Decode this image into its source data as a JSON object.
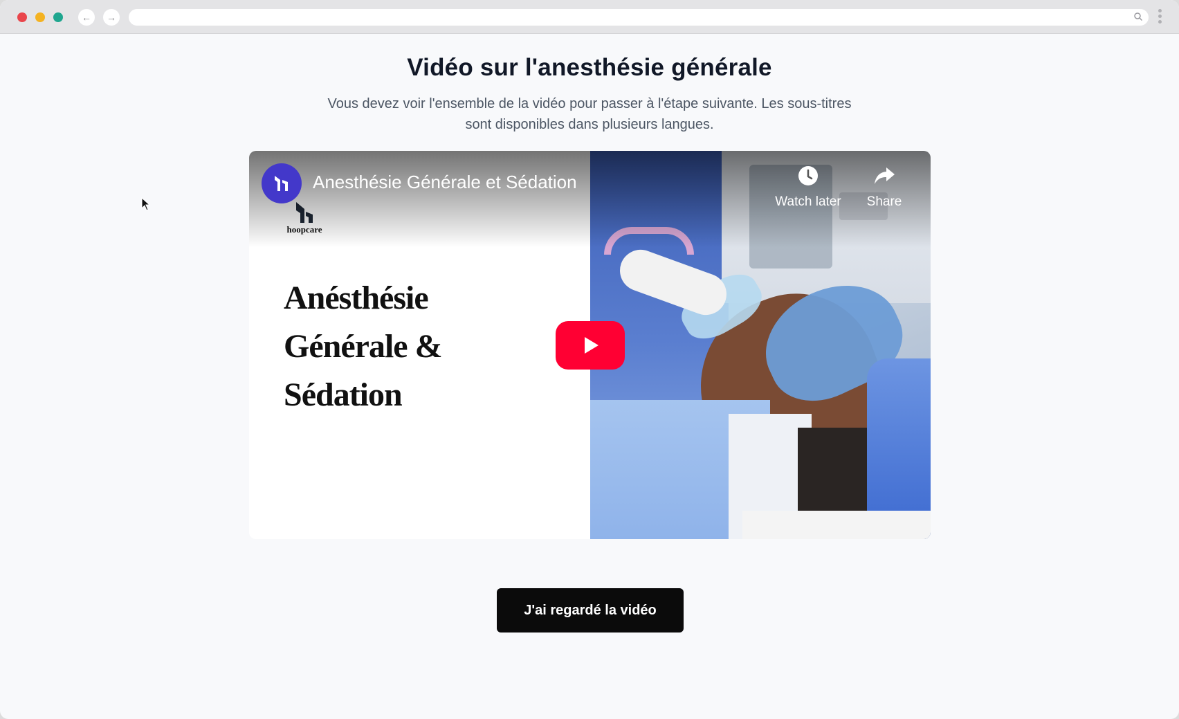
{
  "browser": {
    "back_icon": "arrow-left-icon",
    "forward_icon": "arrow-right-icon",
    "url": "",
    "search_icon": "search-icon",
    "menu_icon": "kebab-menu-icon"
  },
  "page": {
    "title": "Vidéo sur l'anesthésie générale",
    "subtitle": "Vous devez voir l'ensemble de la vidéo pour passer à l'étape suivante. Les sous-titres sont disponibles dans plusieurs langues."
  },
  "video": {
    "title": "Anesthésie Générale et Sédation",
    "brand_name": "hoopcare",
    "thumbnail_title_lines": [
      "Anésthésie",
      "Générale &",
      "Sédation"
    ],
    "actions": {
      "watch_later": "Watch later",
      "share": "Share"
    },
    "colors": {
      "play_button": "#ff0033",
      "channel_avatar": "#4338ca"
    }
  },
  "confirm_button": {
    "label": "J'ai regardé la vidéo"
  }
}
